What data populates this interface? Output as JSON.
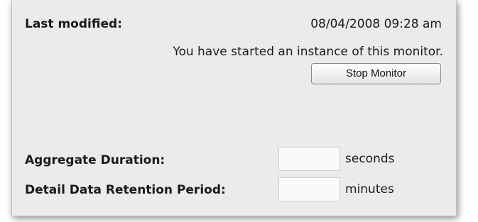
{
  "last_modified": {
    "label": "Last modified:",
    "value": "08/04/2008 09:28 am"
  },
  "status_message": "You have started an instance of this monitor.",
  "stop_button_label": "Stop Monitor",
  "fields": {
    "aggregate_duration": {
      "label": "Aggregate Duration:",
      "value": "",
      "unit": "seconds"
    },
    "detail_retention": {
      "label": "Detail Data Retention Period:",
      "value": "",
      "unit": "minutes"
    }
  }
}
